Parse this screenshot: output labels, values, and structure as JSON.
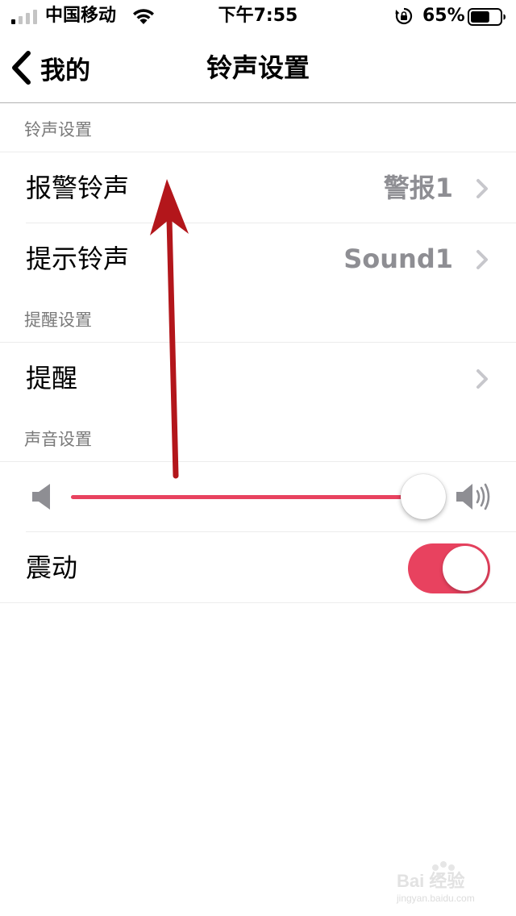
{
  "status_bar": {
    "carrier": "中国移动",
    "time": "下午7:55",
    "battery_percent": "65%",
    "battery_level": 0.65,
    "signal_bars_filled": 1,
    "icons": [
      "signal-icon",
      "wifi-icon",
      "rotation-lock-icon",
      "battery-icon"
    ]
  },
  "nav": {
    "back_label": "我的",
    "title": "铃声设置"
  },
  "sections": {
    "ringtone_header": "铃声设置",
    "reminder_header": "提醒设置",
    "sound_header": "声音设置"
  },
  "rows": {
    "alarm_ringtone": {
      "label": "报警铃声",
      "value": "警报1"
    },
    "notice_ringtone": {
      "label": "提示铃声",
      "value": "Sound1"
    },
    "reminder": {
      "label": "提醒"
    },
    "vibrate": {
      "label": "震动",
      "on": true
    }
  },
  "volume": {
    "level": 1.0
  },
  "colors": {
    "accent": "#e8425f",
    "secondary_text": "#8e8e93",
    "section_text": "#7a7a7a",
    "annotation_arrow": "#b3161b"
  },
  "watermark": {
    "brand": "Bai 经验",
    "domain": "jingyan.baidu.com"
  }
}
